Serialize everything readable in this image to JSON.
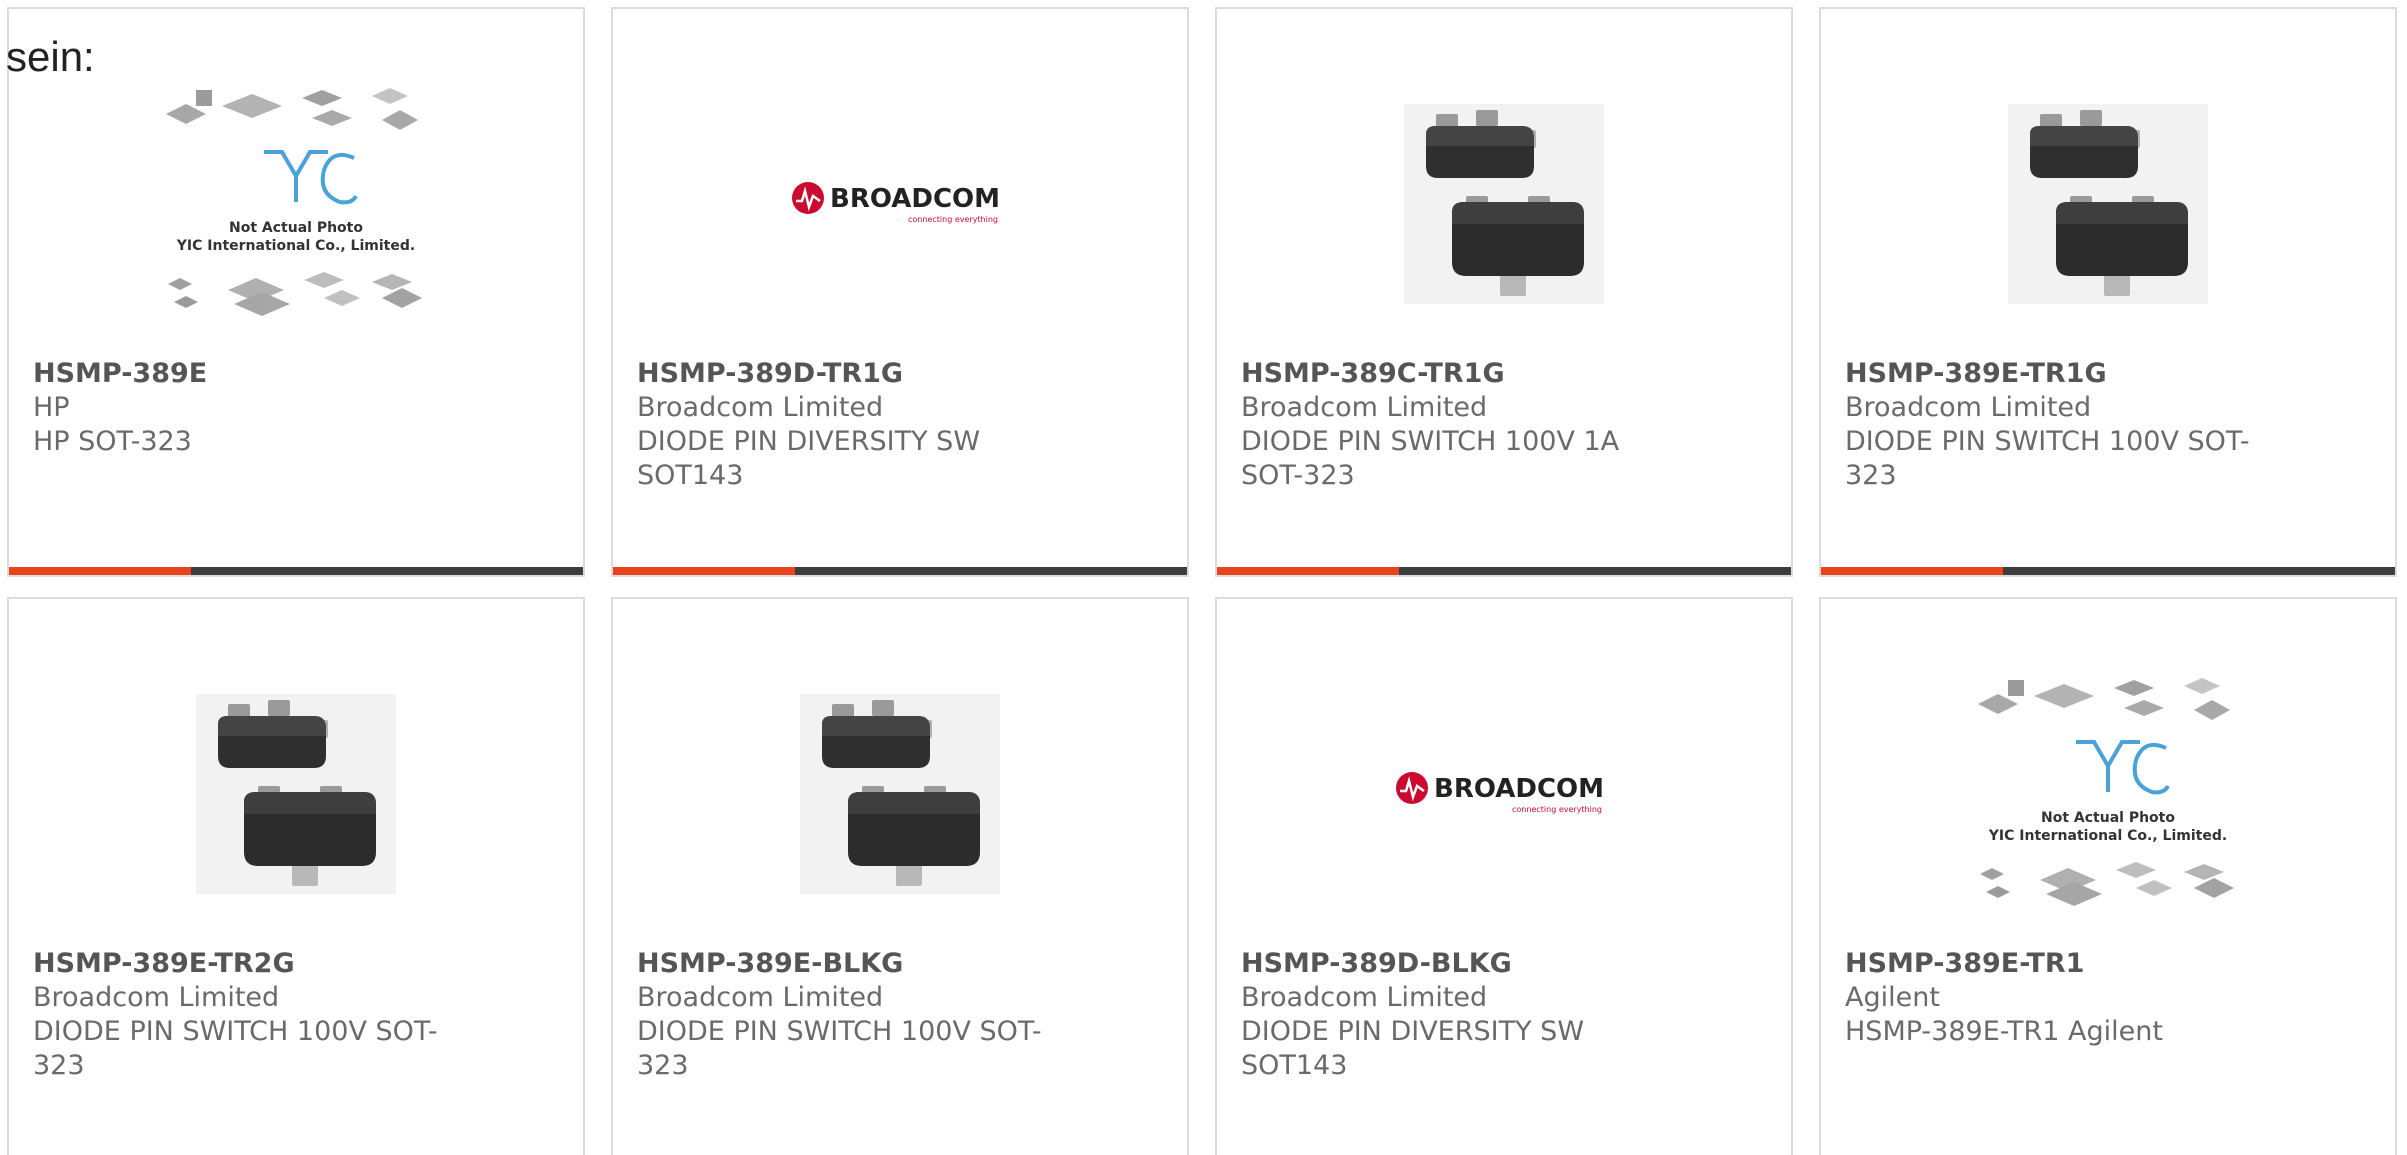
{
  "intro_text": "sein:",
  "colors": {
    "accent": "#e8431b",
    "bar": "#3d3d3d",
    "broadcom_red": "#cc092f"
  },
  "placeholder": {
    "logo_text": "YIC",
    "line1": "Not Actual Photo",
    "line2": "YIC International Co., Limited."
  },
  "broadcom": {
    "name": "BROADCOM",
    "tagline": "connecting everything"
  },
  "products": [
    {
      "part": "HSMP-389E",
      "maker": "HP",
      "desc": "HP SOT-323",
      "image": "placeholder-icon"
    },
    {
      "part": "HSMP-389D-TR1G",
      "maker": "Broadcom Limited",
      "desc": "DIODE PIN DIVERSITY SW SOT143",
      "image": "broadcom-logo"
    },
    {
      "part": "HSMP-389C-TR1G",
      "maker": "Broadcom Limited",
      "desc": "DIODE PIN SWITCH 100V 1A SOT-323",
      "image": "chip-photo"
    },
    {
      "part": "HSMP-389E-TR1G",
      "maker": "Broadcom Limited",
      "desc": "DIODE PIN SWITCH 100V SOT-323",
      "image": "chip-photo"
    },
    {
      "part": "HSMP-389E-TR2G",
      "maker": "Broadcom Limited",
      "desc": "DIODE PIN SWITCH 100V SOT-323",
      "image": "chip-photo"
    },
    {
      "part": "HSMP-389E-BLKG",
      "maker": "Broadcom Limited",
      "desc": "DIODE PIN SWITCH 100V SOT-323",
      "image": "chip-photo"
    },
    {
      "part": "HSMP-389D-BLKG",
      "maker": "Broadcom Limited",
      "desc": "DIODE PIN DIVERSITY SW SOT143",
      "image": "broadcom-logo"
    },
    {
      "part": "HSMP-389E-TR1",
      "maker": "Agilent",
      "desc": "HSMP-389E-TR1 Agilent",
      "image": "placeholder-icon"
    }
  ]
}
